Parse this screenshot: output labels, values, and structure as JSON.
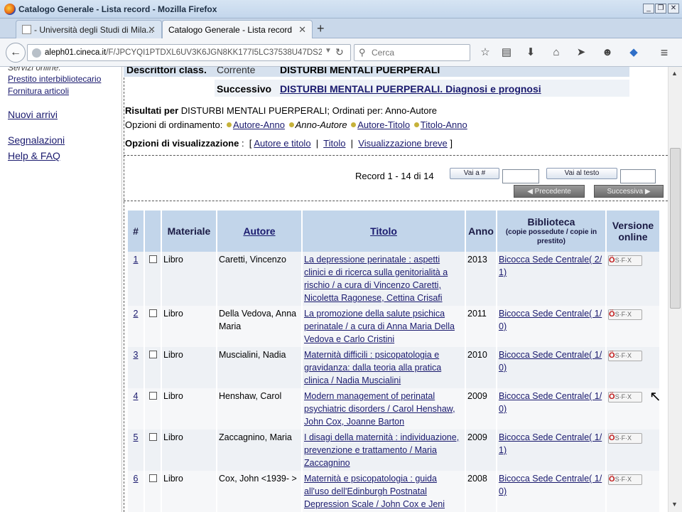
{
  "window": {
    "title": "Catalogo Generale - Lista record - Mozilla Firefox"
  },
  "tabs": [
    {
      "label": "- Università degli Studi di Mila..."
    },
    {
      "label": "Catalogo Generale - Lista record"
    }
  ],
  "navbar": {
    "url_host": "aleph01.cineca.it",
    "url_path": "/F/JPCYQI1PTDXL6UV3K6JGN8KK177I5LC37538U47DS2YLI314(",
    "search_placeholder": "Cerca"
  },
  "sidebar": {
    "cut_item": "Servizi online:",
    "items": [
      "Prestito interbibliotecario",
      "Fornitura articoli",
      "Nuovi arrivi",
      "Segnalazioni",
      "Help & FAQ"
    ]
  },
  "descriptor": {
    "label": "Descrittori class.",
    "current_label": "Corrente",
    "current_value": "DISTURBI MENTALI PUERPERALI",
    "next_label": "Successivo",
    "next_value": "DISTURBI MENTALI PUERPERALI. Diagnosi e prognosi"
  },
  "results": {
    "label": "Risultati per",
    "text": "DISTURBI MENTALI PUERPERALI; Ordinati per: Anno-Autore",
    "sort_label": "Opzioni di ordinamento:",
    "sort_options": [
      "Autore-Anno",
      "Anno-Autore",
      "Autore-Titolo",
      "Titolo-Anno"
    ],
    "view_label": "Opzioni di visualizzazione",
    "view_options": [
      "Autore e titolo",
      "Titolo",
      "Visualizzazione breve"
    ],
    "record_text": "Record 1 - 14 di 14",
    "goto_button": "Vai a #",
    "goto_text_button": "Vai al testo",
    "prev_button": "Precedente",
    "next_button": "Successiva"
  },
  "table": {
    "headers": {
      "num": "#",
      "material": "Materiale",
      "author": "Autore",
      "title": "Titolo",
      "year": "Anno",
      "library": "Biblioteca",
      "library_sub": "(copie possedute / copie in prestito)",
      "online": "Versione online"
    },
    "sfx_label": "S·F·X",
    "rows": [
      {
        "n": "1",
        "material": "Libro",
        "author": "Caretti, Vincenzo",
        "title": "La depressione perinatale : aspetti clinici e di ricerca sulla genitorialità a rischio / a cura di Vincenzo Caretti, Nicoletta Ragonese, Cettina Crisafi",
        "year": "2013",
        "library": "Bicocca Sede Centrale( 2/ 1)"
      },
      {
        "n": "2",
        "material": "Libro",
        "author": "Della Vedova, Anna Maria",
        "title": "La promozione della salute psichica perinatale / a cura di Anna Maria Della Vedova e Carlo Cristini",
        "year": "2011",
        "library": "Bicocca Sede Centrale( 1/ 0)"
      },
      {
        "n": "3",
        "material": "Libro",
        "author": "Muscialini, Nadia",
        "title": "Maternità difficili : psicopatologia e gravidanza: dalla teoria alla pratica clinica / Nadia Muscialini",
        "year": "2010",
        "library": "Bicocca Sede Centrale( 1/ 0)"
      },
      {
        "n": "4",
        "material": "Libro",
        "author": "Henshaw, Carol",
        "title": "Modern management of perinatal psychiatric disorders / Carol Henshaw, John Cox, Joanne Barton",
        "year": "2009",
        "library": "Bicocca Sede Centrale( 1/ 0)"
      },
      {
        "n": "5",
        "material": "Libro",
        "author": "Zaccagnino, Maria",
        "title": "I disagi della maternità : individuazione, prevenzione e trattamento / Maria Zaccagnino",
        "year": "2009",
        "library": "Bicocca Sede Centrale( 1/ 1)"
      },
      {
        "n": "6",
        "material": "Libro",
        "author": "Cox, John <1939- >",
        "title": "Maternità e psicopatologia : guida all'uso dell'Edinburgh Postnatal Depression Scale / John Cox e Jeni",
        "year": "2008",
        "library": "Bicocca Sede Centrale( 1/ 0)"
      }
    ]
  }
}
